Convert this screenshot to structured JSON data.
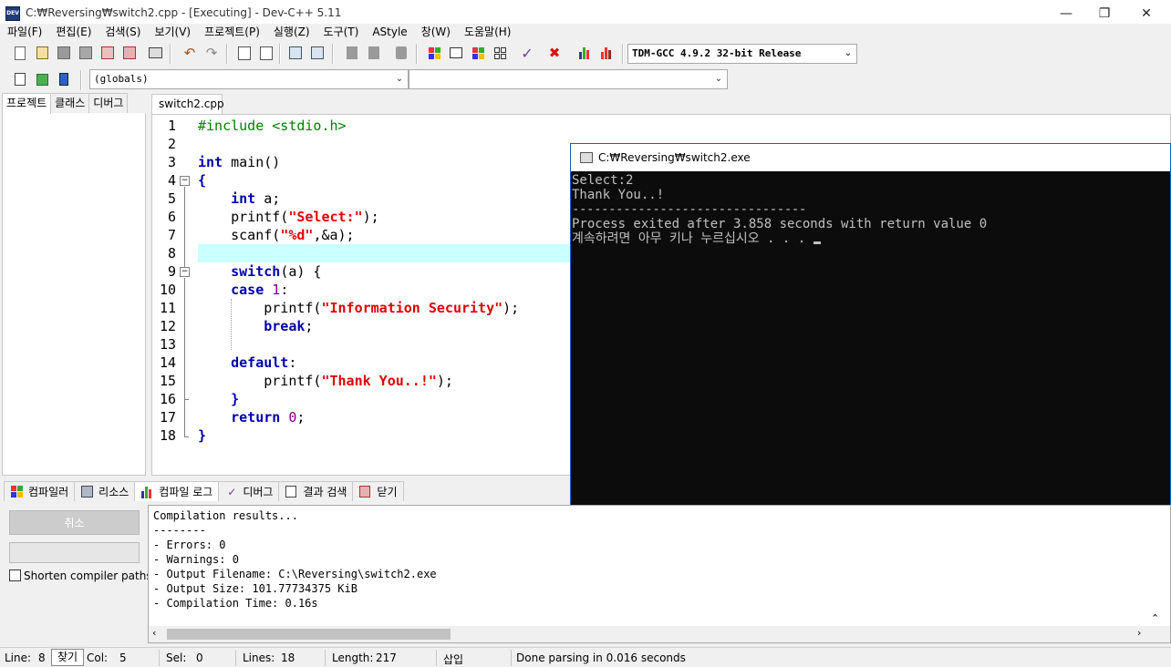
{
  "window": {
    "title": "C:₩Reversing₩switch2.cpp - [Executing] - Dev-C++ 5.11",
    "app_icon_text": "DEV"
  },
  "menu": [
    "파일(F)",
    "편집(E)",
    "검색(S)",
    "보기(V)",
    "프로젝트(P)",
    "실행(Z)",
    "도구(T)",
    "AStyle",
    "창(W)",
    "도움말(H)"
  ],
  "toolbar": {
    "compiler_select": "TDM-GCC 4.9.2 32-bit Release",
    "scope_select": "(globals)",
    "function_select": ""
  },
  "left_tabs": [
    "프로젝트",
    "클래스",
    "디버그"
  ],
  "editor": {
    "tab_label": "switch2.cpp",
    "line_numbers": [
      "1",
      "2",
      "3",
      "4",
      "5",
      "6",
      "7",
      "8",
      "9",
      "10",
      "11",
      "12",
      "13",
      "14",
      "15",
      "16",
      "17",
      "18"
    ],
    "lines": [
      [
        {
          "t": "#include <stdio.h>",
          "c": "pp"
        }
      ],
      [],
      [
        {
          "t": "int",
          "c": "kw"
        },
        {
          "t": " main()",
          "c": "fn"
        }
      ],
      [
        {
          "t": "{",
          "c": "kw"
        }
      ],
      [
        {
          "t": "    ",
          "c": "fn"
        },
        {
          "t": "int",
          "c": "kw"
        },
        {
          "t": " a;",
          "c": "fn"
        }
      ],
      [
        {
          "t": "    printf(",
          "c": "fn"
        },
        {
          "t": "\"Select:\"",
          "c": "str"
        },
        {
          "t": ");",
          "c": "fn"
        }
      ],
      [
        {
          "t": "    scanf(",
          "c": "fn"
        },
        {
          "t": "\"%d\"",
          "c": "str"
        },
        {
          "t": ",&a);",
          "c": "fn"
        }
      ],
      [],
      [
        {
          "t": "    ",
          "c": "fn"
        },
        {
          "t": "switch",
          "c": "kw"
        },
        {
          "t": "(a) {",
          "c": "fn"
        }
      ],
      [
        {
          "t": "    ",
          "c": "fn"
        },
        {
          "t": "case",
          "c": "kw"
        },
        {
          "t": " ",
          "c": "fn"
        },
        {
          "t": "1",
          "c": "num"
        },
        {
          "t": ":",
          "c": "fn"
        }
      ],
      [
        {
          "t": "        printf(",
          "c": "fn"
        },
        {
          "t": "\"Information Security\"",
          "c": "str"
        },
        {
          "t": ");",
          "c": "fn"
        }
      ],
      [
        {
          "t": "        ",
          "c": "fn"
        },
        {
          "t": "break",
          "c": "kw"
        },
        {
          "t": ";",
          "c": "fn"
        }
      ],
      [],
      [
        {
          "t": "    ",
          "c": "fn"
        },
        {
          "t": "default",
          "c": "kw"
        },
        {
          "t": ":",
          "c": "fn"
        }
      ],
      [
        {
          "t": "        printf(",
          "c": "fn"
        },
        {
          "t": "\"Thank You..!\"",
          "c": "str"
        },
        {
          "t": ");",
          "c": "fn"
        }
      ],
      [
        {
          "t": "    ",
          "c": "fn"
        },
        {
          "t": "}",
          "c": "kw"
        }
      ],
      [
        {
          "t": "    ",
          "c": "fn"
        },
        {
          "t": "return",
          "c": "kw"
        },
        {
          "t": " ",
          "c": "fn"
        },
        {
          "t": "0",
          "c": "num"
        },
        {
          "t": ";",
          "c": "fn"
        }
      ],
      [
        {
          "t": "}",
          "c": "kw"
        }
      ]
    ]
  },
  "console": {
    "title": "C:₩Reversing₩switch2.exe",
    "lines": [
      "Select:2",
      "Thank You..!",
      "--------------------------------",
      "Process exited after 3.858 seconds with return value 0",
      "계속하려면 아무 키나 누르십시오 . . . "
    ]
  },
  "bottom_tabs": [
    "컴파일러",
    "리소스",
    "컴파일 로그",
    "디버그",
    "결과 검색",
    "닫기"
  ],
  "compile_panel": {
    "cancel_label": "취소",
    "shorten_label": "Shorten compiler paths"
  },
  "log_lines": [
    "Compilation results...",
    "--------",
    "- Errors: 0",
    "- Warnings: 0",
    "- Output Filename: C:\\Reversing\\switch2.exe",
    "- Output Size: 101.77734375 KiB",
    "- Compilation Time: 0.16s"
  ],
  "status": {
    "line_label": "Line:",
    "line_value": "8",
    "find_label": "찾기",
    "col_label": "Col:",
    "col_value": "5",
    "sel_label": "Sel:",
    "sel_value": "0",
    "lines_label": "Lines:",
    "lines_value": "18",
    "length_label": "Length:",
    "length_value": "217",
    "mode": "삽입",
    "message": "Done parsing in 0.016 seconds"
  }
}
